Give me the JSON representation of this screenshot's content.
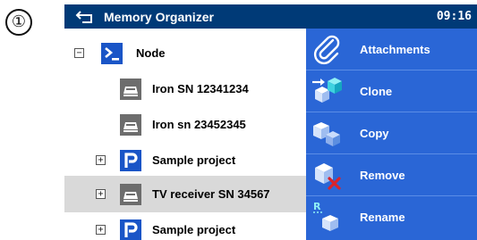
{
  "marker": "①",
  "header": {
    "title": "Memory Organizer",
    "time": "09:16"
  },
  "tree": {
    "items": [
      {
        "label": "Node",
        "toggle": "−",
        "icon": "node-icon"
      },
      {
        "label": "Iron SN 12341234",
        "icon": "appliance-icon"
      },
      {
        "label": "Iron sn 23452345",
        "icon": "appliance-icon"
      },
      {
        "label": "Sample project",
        "toggle": "+",
        "icon": "project-icon"
      },
      {
        "label": "TV receiver SN 34567",
        "toggle": "+",
        "icon": "appliance-icon",
        "selected": true
      },
      {
        "label": "Sample project",
        "toggle": "+",
        "icon": "project-icon"
      }
    ]
  },
  "menu": {
    "items": [
      {
        "label": "Attachments",
        "icon": "paperclip-icon"
      },
      {
        "label": "Clone",
        "icon": "clone-icon"
      },
      {
        "label": "Copy",
        "icon": "copy-icon"
      },
      {
        "label": "Remove",
        "icon": "remove-icon"
      },
      {
        "label": "Rename",
        "icon": "rename-icon"
      }
    ]
  },
  "colors": {
    "header_bg": "#003a77",
    "panel_bg": "#2a66d6",
    "selected_row": "#d9d9d9",
    "icon_blue": "#1a55c7",
    "remove_x": "#d9232b"
  }
}
